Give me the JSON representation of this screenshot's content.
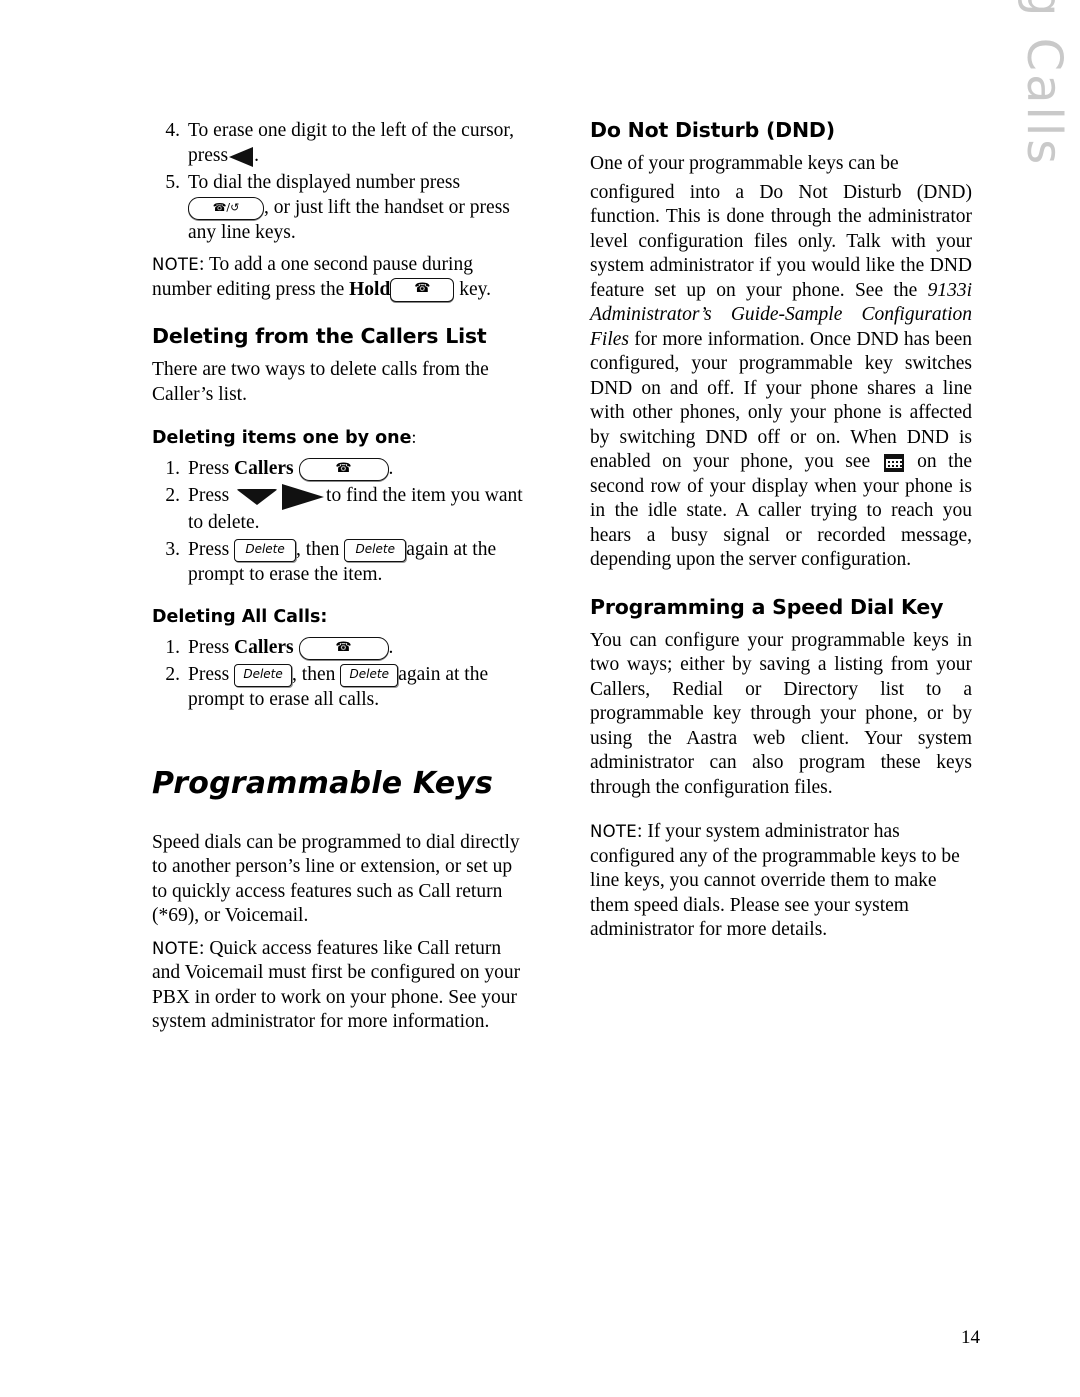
{
  "sidebar": {
    "vertical_title": "Managing Calls"
  },
  "page_number": "14",
  "left_column": {
    "steps_top": [
      {
        "num": "4.",
        "text": "To erase one digit to the left of the cursor, press"
      },
      {
        "num": "5.",
        "text": "To dial the displayed number press"
      }
    ],
    "step5_cont": ", or just lift the handset or press any line keys.",
    "note1": {
      "label": "NOTE",
      "text_a": ": To add a one second pause during number editing press the ",
      "bold": "Hold",
      "text_b": " key."
    },
    "heading_callers_list": "Deleting from the Callers List",
    "para_callers_list": "There are two ways to delete calls from the Caller’s list.",
    "sub_one_by_one": "Deleting items one by one",
    "sub_one_by_one_colon": ":",
    "steps_one_by_one": [
      {
        "num": "1.",
        "pre": "Press ",
        "bold": "Callers",
        "post": "."
      },
      {
        "num": "2.",
        "pre": "Press ",
        "post": "to find the item you want to delete."
      },
      {
        "num": "3.",
        "pre": "Press ",
        "mid": ", then ",
        "post": "again at the prompt to erase the item."
      }
    ],
    "sub_all_calls": "Deleting All Calls:",
    "steps_all_calls": [
      {
        "num": "1.",
        "pre": "Press ",
        "bold": "Callers",
        "post": "."
      },
      {
        "num": "2.",
        "pre": "Press ",
        "mid": ", then ",
        "post": "again at the prompt to erase all calls."
      }
    ],
    "heading_programmable_keys": "Programmable Keys",
    "para_speed_dials": "Speed dials can be programmed to dial directly to another person’s line or extension, or set up to quickly access features such as Call return (*69), or Voicemail.",
    "note2": {
      "label": "NOTE",
      "text": ": Quick access features like Call return and Voicemail must first be configured on your PBX in order to work on your phone. See your system administrator for more information."
    },
    "keys": {
      "dial_key_label": "☎/↺",
      "delete_label": "Delete",
      "callers_key": "callers-key",
      "hold_key": "hold-key"
    }
  },
  "right_column": {
    "heading_dnd": "Do Not Disturb (DND)",
    "dnd_para_1": "One of your programmable keys can be",
    "dnd_para_2a": " configured into a Do Not Disturb (DND) function. This is done through the administrator level configuration files only. Talk with your system administrator if you would like the DND feature set up on your phone. See the ",
    "dnd_italic": "9133i Administrator’s Guide-Sample Configuration Files",
    "dnd_para_2b": " for more information. Once DND has been configured, your programmable key switches DND on and off. If your phone shares a line with other phones, only your phone is affected by switching DND off or on. When DND is enabled on your phone, you see ",
    "dnd_para_2c": " on the second row of your display when your phone is in the idle state. A caller trying to reach you hears a busy signal or recorded message, depending upon the server configuration.",
    "heading_speed_dial": "Programming a Speed Dial Key",
    "speed_dial_para": "You can configure your programmable keys in two ways; either by saving a listing from your Callers, Redial or Directory list to a programmable key through your phone, or by using the Aastra web client. Your system administrator can also program these keys through the configuration files.",
    "note": {
      "label": "NOTE",
      "text": ": If your system administrator has configured any of the programmable keys to be line keys, you cannot override them to make them speed dials. Please see your system administrator for more details."
    }
  }
}
